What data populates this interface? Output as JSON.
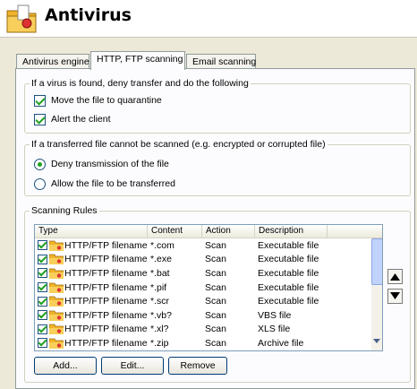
{
  "header": {
    "title": "Antivirus",
    "icon": "antivirus-folder-icon"
  },
  "tabs": [
    {
      "label": "Antivirus engine",
      "active": false
    },
    {
      "label": "HTTP, FTP scanning",
      "active": true
    },
    {
      "label": "Email scanning",
      "active": false
    }
  ],
  "virus_found": {
    "legend": "If a virus is found, deny transfer and do the following",
    "options": [
      {
        "label": "Move the file to quarantine",
        "checked": true
      },
      {
        "label": "Alert the client",
        "checked": true
      }
    ]
  },
  "cannot_scan": {
    "legend": "If a transferred file cannot be scanned (e.g. encrypted or corrupted file)",
    "options": [
      {
        "label": "Deny transmission of the file",
        "selected": true
      },
      {
        "label": "Allow the file to be transferred",
        "selected": false
      }
    ]
  },
  "rules": {
    "legend": "Scanning Rules",
    "columns": [
      "Type",
      "Content",
      "Action",
      "Description"
    ],
    "rows": [
      {
        "checked": true,
        "type": "HTTP/FTP filename",
        "content": "*.com",
        "action": "Scan",
        "description": "Executable file"
      },
      {
        "checked": true,
        "type": "HTTP/FTP filename",
        "content": "*.exe",
        "action": "Scan",
        "description": "Executable file"
      },
      {
        "checked": true,
        "type": "HTTP/FTP filename",
        "content": "*.bat",
        "action": "Scan",
        "description": "Executable file"
      },
      {
        "checked": true,
        "type": "HTTP/FTP filename",
        "content": "*.pif",
        "action": "Scan",
        "description": "Executable file"
      },
      {
        "checked": true,
        "type": "HTTP/FTP filename",
        "content": "*.scr",
        "action": "Scan",
        "description": "Executable file"
      },
      {
        "checked": true,
        "type": "HTTP/FTP filename",
        "content": "*.vb?",
        "action": "Scan",
        "description": "VBS file"
      },
      {
        "checked": true,
        "type": "HTTP/FTP filename",
        "content": "*.xl?",
        "action": "Scan",
        "description": "XLS file"
      },
      {
        "checked": true,
        "type": "HTTP/FTP filename",
        "content": "*.zip",
        "action": "Scan",
        "description": "Archive file"
      }
    ],
    "buttons": {
      "add": "Add...",
      "edit": "Edit...",
      "remove": "Remove"
    }
  },
  "colors": {
    "accent_check": "#21a121",
    "folder": "#f0b429",
    "header_bg": "#ffffff",
    "dialog_bg": "#ece9d8"
  }
}
